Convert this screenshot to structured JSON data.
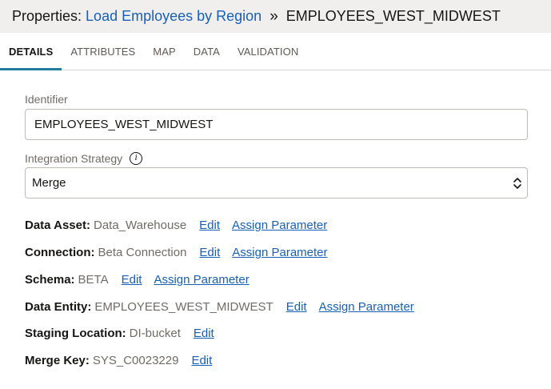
{
  "header": {
    "prefix": "Properties:",
    "operator_link": "Load Employees by Region",
    "separator": "»",
    "entity": "EMPLOYEES_WEST_MIDWEST"
  },
  "tabs": [
    {
      "label": "DETAILS",
      "active": true
    },
    {
      "label": "ATTRIBUTES",
      "active": false
    },
    {
      "label": "MAP",
      "active": false
    },
    {
      "label": "DATA",
      "active": false
    },
    {
      "label": "VALIDATION",
      "active": false
    }
  ],
  "identifier": {
    "label": "Identifier",
    "value": "EMPLOYEES_WEST_MIDWEST"
  },
  "integration_strategy": {
    "label": "Integration Strategy",
    "info_icon": "info-icon",
    "selected": "Merge"
  },
  "properties": [
    {
      "key": "Data Asset:",
      "value": "Data_Warehouse",
      "edit": "Edit",
      "assign": "Assign Parameter"
    },
    {
      "key": "Connection:",
      "value": "Beta Connection",
      "edit": "Edit",
      "assign": "Assign Parameter"
    },
    {
      "key": "Schema:",
      "value": "BETA",
      "edit": "Edit",
      "assign": "Assign Parameter"
    },
    {
      "key": "Data Entity:",
      "value": "EMPLOYEES_WEST_MIDWEST",
      "edit": "Edit",
      "assign": "Assign Parameter"
    },
    {
      "key": "Staging Location:",
      "value": "DI-bucket",
      "edit": "Edit"
    },
    {
      "key": "Merge Key:",
      "value": "SYS_C0023229",
      "edit": "Edit"
    }
  ],
  "colors": {
    "link": "#1760b8",
    "active_tab_underline": "#227e9e",
    "header_bg": "#f1efed"
  }
}
